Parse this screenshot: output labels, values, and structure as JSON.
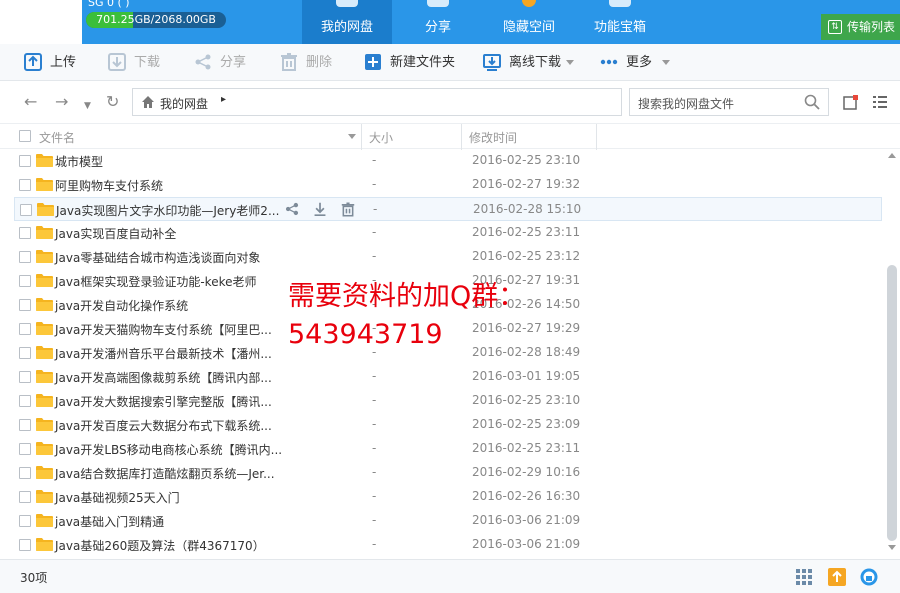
{
  "header": {
    "storage_text": "701.25GB/2068.00GB",
    "storage_fraction": 0.339,
    "user_fragment": "SG 0 ( )",
    "tabs": [
      {
        "label": "我的网盘",
        "active": true
      },
      {
        "label": "分享",
        "active": false
      },
      {
        "label": "隐藏空间",
        "active": false
      },
      {
        "label": "功能宝箱",
        "active": false
      }
    ],
    "transfer_label": "传输列表",
    "colors": {
      "header_blue": "#2a96e8",
      "active_tab": "#1b7dcc",
      "transfer_green": "#3ea64b"
    }
  },
  "toolbar": {
    "upload": "上传",
    "download": "下载",
    "share": "分享",
    "delete": "删除",
    "new_folder": "新建文件夹",
    "offline_download": "离线下载",
    "more": "更多"
  },
  "address": {
    "crumb": "我的网盘",
    "separator": "▸",
    "search_placeholder": "搜索我的网盘文件"
  },
  "columns": {
    "name": "文件名",
    "size": "大小",
    "modified": "修改时间"
  },
  "files": [
    {
      "name": "城市模型",
      "size": "-",
      "time": "2016-02-25 23:10"
    },
    {
      "name": "阿里购物车支付系统",
      "size": "-",
      "time": "2016-02-27 19:32"
    },
    {
      "name": "Java实现图片文字水印功能—Jery老师2...",
      "size": "-",
      "time": "2016-02-28 15:10"
    },
    {
      "name": "Java实现百度自动补全",
      "size": "-",
      "time": "2016-02-25 23:11"
    },
    {
      "name": "Java零基础结合城市构造浅谈面向对象",
      "size": "-",
      "time": "2016-02-25 23:12"
    },
    {
      "name": "Java框架实现登录验证功能-keke老师",
      "size": "-",
      "time": "2016-02-27 19:31"
    },
    {
      "name": "java开发自动化操作系统",
      "size": "-",
      "time": "2016-02-26 14:50"
    },
    {
      "name": "Java开发天猫购物车支付系统【阿里巴...",
      "size": "-",
      "time": "2016-02-27 19:29"
    },
    {
      "name": "Java开发潘州音乐平台最新技术【潘州...",
      "size": "-",
      "time": "2016-02-28 18:49"
    },
    {
      "name": "Java开发高端图像裁剪系统【腾讯内部...",
      "size": "-",
      "time": "2016-03-01 19:05"
    },
    {
      "name": "Java开发大数据搜索引擎完整版【腾讯...",
      "size": "-",
      "time": "2016-02-25 23:10"
    },
    {
      "name": "Java开发百度云大数据分布式下载系统...",
      "size": "-",
      "time": "2016-02-25 23:09"
    },
    {
      "name": "Java开发LBS移动电商核心系统【腾讯内...",
      "size": "-",
      "time": "2016-02-25 23:11"
    },
    {
      "name": "Java结合数据库打造酷炫翻页系统—Jer...",
      "size": "-",
      "time": "2016-02-29 10:16"
    },
    {
      "name": "Java基础视频25天入门",
      "size": "-",
      "time": "2016-02-26 16:30"
    },
    {
      "name": "java基础入门到精通",
      "size": "-",
      "time": "2016-03-06 21:09"
    },
    {
      "name": "Java基础260题及算法（群4367170）",
      "size": "-",
      "time": "2016-03-06 21:09"
    }
  ],
  "status": {
    "count": "30项"
  },
  "overlay": {
    "line1": "需要资料的加Q群：",
    "line2": "543943719"
  }
}
